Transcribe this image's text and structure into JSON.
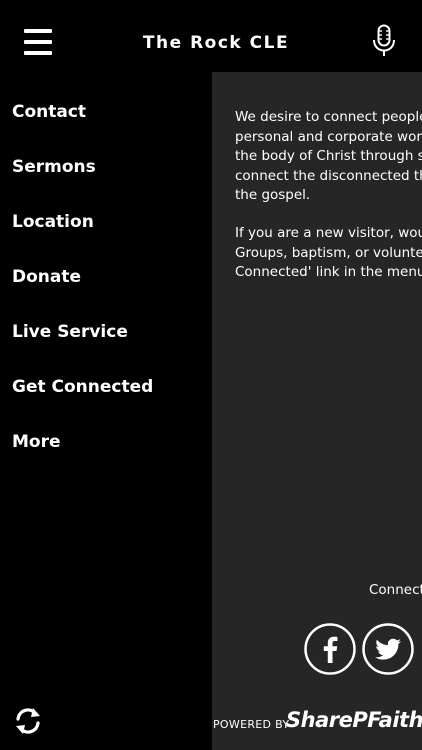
{
  "header": {
    "title": "The Rock CLE",
    "menu_icon": "hamburger-menu-icon",
    "mic_icon": "microphone-icon"
  },
  "sidebar": {
    "items": [
      {
        "label": "Contact"
      },
      {
        "label": "Sermons"
      },
      {
        "label": "Location"
      },
      {
        "label": "Donate"
      },
      {
        "label": "Live Service"
      },
      {
        "label": "Get Connected"
      },
      {
        "label": "More"
      }
    ],
    "refresh_icon": "refresh-icon"
  },
  "content": {
    "paragraph1_lines": [
      "We desire to connect people",
      "personal and corporate wors",
      "the body of Christ through sm",
      "connect the disconnected thr",
      "the gospel."
    ],
    "paragraph2_lines": [
      "If you are a new visitor, woul",
      "Groups, baptism, or voluntee",
      "Connected' link in the menu."
    ],
    "connect_label": "Connect",
    "social": [
      {
        "icon": "facebook-icon"
      },
      {
        "icon": "twitter-icon"
      }
    ],
    "footer": {
      "powered_by": "POWERED BY",
      "brand": "SharePFaith"
    }
  },
  "colors": {
    "background": "#000000",
    "content_panel": "#262626",
    "text": "#ffffff"
  }
}
